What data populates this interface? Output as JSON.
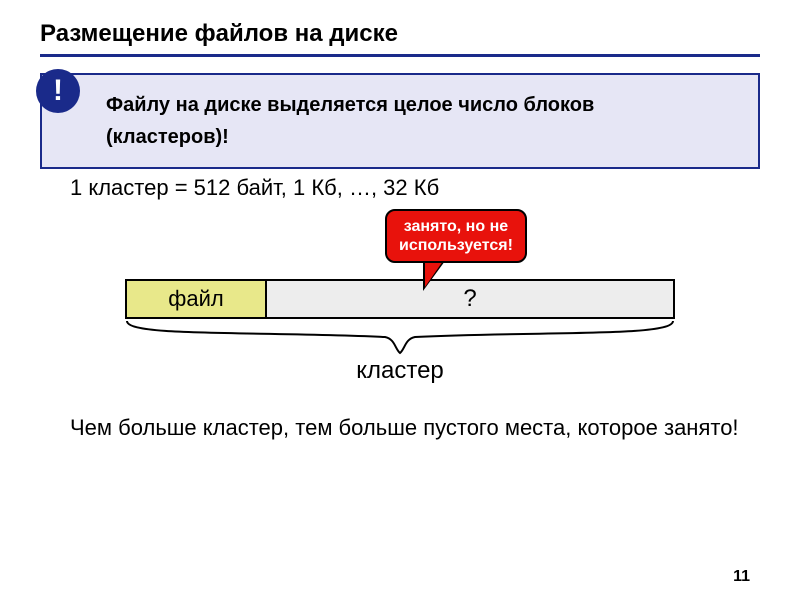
{
  "title": "Размещение файлов на диске",
  "callout": {
    "bang": "!",
    "line1": "Файлу на диске выделяется целое число блоков",
    "line2": "(кластеров)!"
  },
  "cluster_eq": "1 кластер = 512 байт, 1 Кб, …, 32 Кб",
  "speech": {
    "line1": "занято, но не",
    "line2": "используется!"
  },
  "bar": {
    "file_label": "файл",
    "rest_label": "?"
  },
  "brace_label": "кластер",
  "bottom_text": "Чем больше кластер, тем больше пустого места, которое занято!",
  "page_number": "11"
}
